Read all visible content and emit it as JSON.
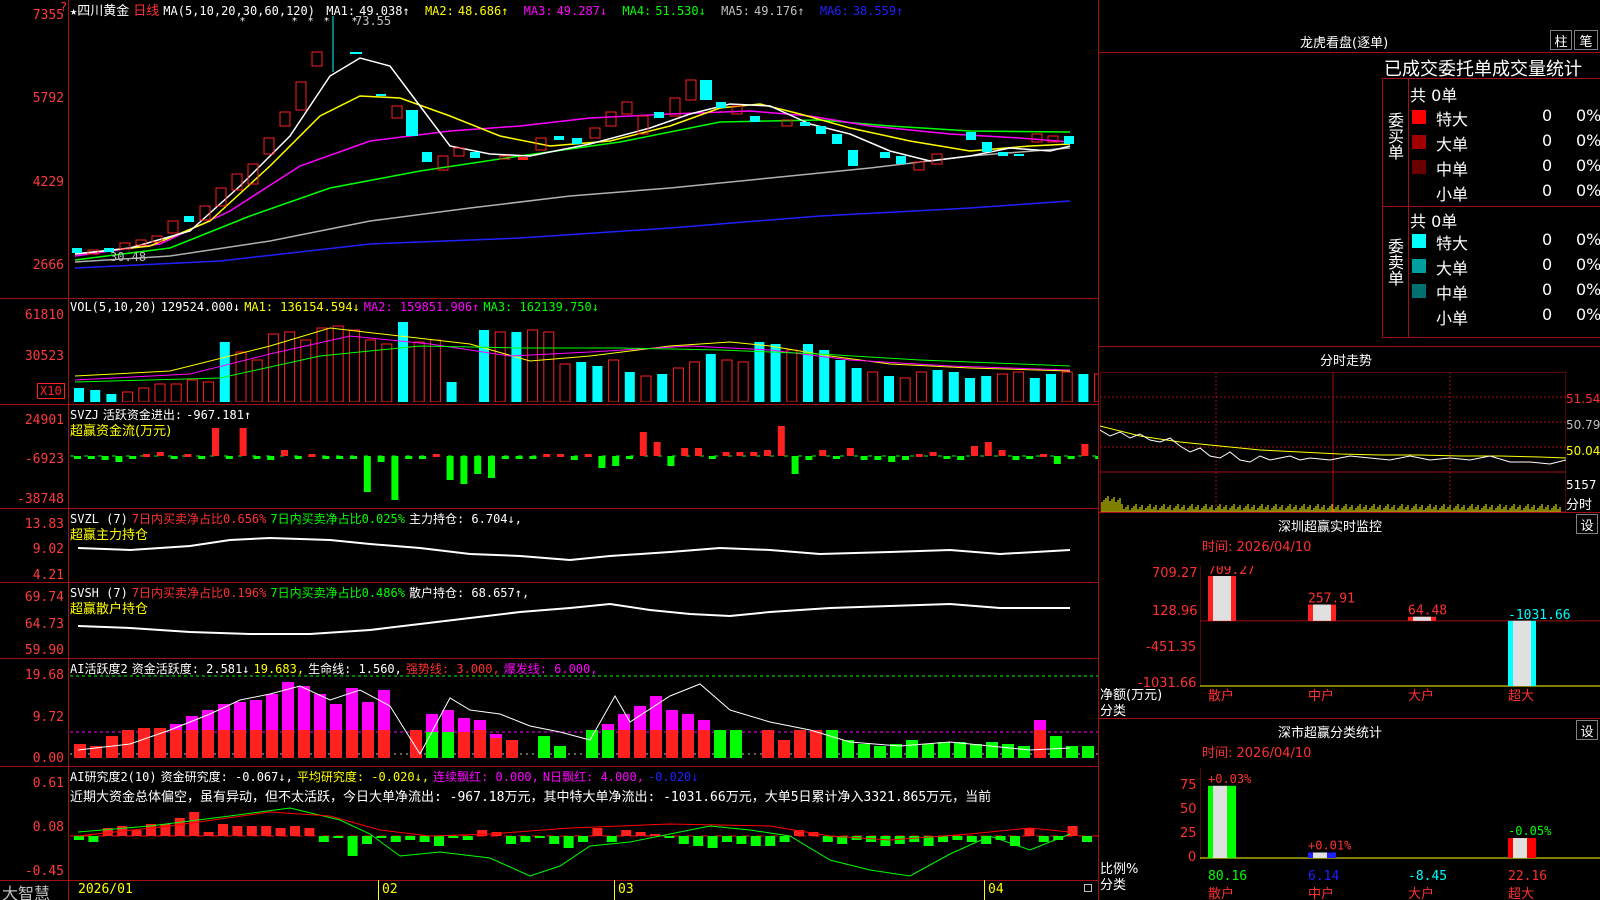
{
  "main": {
    "title_star": "★",
    "stock_name": "四川黄金",
    "period": "日线",
    "ma_def": "MA(5,10,20,30,60,120)",
    "ma": [
      {
        "label": "MA1:",
        "value": "49.038↑",
        "color": "#ffffff"
      },
      {
        "label": "MA2:",
        "value": "48.686↑",
        "color": "#ffff00"
      },
      {
        "label": "MA3:",
        "value": "49.287↓",
        "color": "#ff00ff"
      },
      {
        "label": "MA4:",
        "value": "51.530↓",
        "color": "#00ff00"
      },
      {
        "label": "MA5:",
        "value": "49.176↑",
        "color": "#c0c0c0"
      },
      {
        "label": "MA6:",
        "value": "38.559↑",
        "color": "#2020ff"
      }
    ],
    "y_ticks": [
      "7355",
      "5792",
      "4229",
      "2666"
    ],
    "high_label": "73.55",
    "low_label": "30.48",
    "question_mark": "?",
    "date_ticks": [
      "2026/01",
      "02",
      "03",
      "04"
    ],
    "bottom_logo": "大智慧"
  },
  "vol": {
    "name": "VOL(5,10,20)",
    "value": "129524.000↓",
    "ma1": "MA1: 136154.594↓",
    "ma2": "MA2: 159851.906↑",
    "ma3": "MA3: 162139.750↓",
    "y_ticks": [
      "61810",
      "30523"
    ],
    "unit": "X10"
  },
  "svzj": {
    "name": "SVZJ",
    "label": "活跃资金进出:",
    "value": "-967.181↑",
    "subtitle": "超赢资金流(万元)",
    "y_ticks": [
      "24901",
      "-6923",
      "-38748"
    ]
  },
  "svzl": {
    "name": "SVZL (7)",
    "t1": "7日内买卖净占比0.656%",
    "t2": "7日内买卖净占比0.025%",
    "t3": "主力持仓: 6.704↓,",
    "subtitle": "超赢主力持仓",
    "y_ticks": [
      "13.83",
      "9.02",
      "4.21"
    ]
  },
  "svsh": {
    "name": "SVSH (7)",
    "t1": "7日内买卖净占比0.196%",
    "t2": "7日内买卖净占比0.486%",
    "t3": "散户持仓: 68.657↑,",
    "subtitle": "超赢散户持仓",
    "y_ticks": [
      "69.74",
      "64.73",
      "59.90"
    ]
  },
  "ai1": {
    "name": "AI活跃度2",
    "t1": "资金活跃度: 2.581↓",
    "t2": "19.683,",
    "t3": "生命线: 1.560,",
    "t4": "强势线: 3.000,",
    "t5": "爆发线: 6.000,",
    "y_ticks": [
      "19.68",
      "9.72",
      "0.00"
    ]
  },
  "ai2": {
    "name": "AI研究度2(10)",
    "t1": "资金研究度: -0.067↓,",
    "t2": "平均研究度: -0.020↓,",
    "t3": "连续飘红: 0.000,",
    "t4": "N日飘红: 4.000,",
    "t5": "-0.020↓",
    "comment": "近期大资金总体偏空，虽有异动，但不太活跃，今日大单净流出: -967.18万元，其中特大单净流出: -1031.66万元，大单5日累计净入3321.865万元，当前",
    "y_ticks": [
      "0.61",
      "0.08",
      "-0.45"
    ]
  },
  "lhb": {
    "title": "龙虎看盘(逐单)",
    "btn1": "柱",
    "btn2": "笔",
    "header": "已成交委托单成交量统计",
    "buy_side": "委买单",
    "sell_side": "委卖单",
    "buy_total": "共 0单",
    "sell_total": "共 0单",
    "buy_rows": [
      {
        "name": "特大",
        "count": "0",
        "pct": "0%",
        "color": "#ff0000"
      },
      {
        "name": "大单",
        "count": "0",
        "pct": "0%",
        "color": "#a00000"
      },
      {
        "name": "中单",
        "count": "0",
        "pct": "0%",
        "color": "#6a0000"
      },
      {
        "name": "小单",
        "count": "0",
        "pct": "0%",
        "color": "#000000"
      }
    ],
    "sell_rows": [
      {
        "name": "特大",
        "count": "0",
        "pct": "0%",
        "color": "#00ffff"
      },
      {
        "name": "大单",
        "count": "0",
        "pct": "0%",
        "color": "#00a0a0"
      },
      {
        "name": "中单",
        "count": "0",
        "pct": "0%",
        "color": "#007070"
      },
      {
        "name": "小单",
        "count": "0",
        "pct": "0%",
        "color": "#000000"
      }
    ]
  },
  "intraday": {
    "title": "分时走势",
    "right_ticks": [
      "51.54",
      "50.79",
      "50.04",
      "5157"
    ],
    "unit": "分时"
  },
  "monitor": {
    "title": "深圳超赢实时监控",
    "btn": "设",
    "time": "时间: 2026/04/10",
    "y_ticks": [
      "709.27",
      "128.96",
      "-451.35",
      "-1031.66"
    ],
    "y_unit1": "净额(万元)",
    "y_unit2": "分类",
    "bars": [
      {
        "name": "散户",
        "value": 709.27,
        "label": "709.27"
      },
      {
        "name": "中户",
        "value": 257.91,
        "label": "257.91"
      },
      {
        "name": "大户",
        "value": 64.48,
        "label": "64.48"
      },
      {
        "name": "超大",
        "value": -1031.66,
        "label": "-1031.66"
      }
    ]
  },
  "classify": {
    "title": "深市超赢分类统计",
    "btn": "设",
    "time": "时间: 2026/04/10",
    "y_ticks": [
      "75",
      "50",
      "25",
      "0"
    ],
    "y_unit1": "比例%",
    "y_unit2": "分类",
    "bars": [
      {
        "name": "散户",
        "value": 80.16,
        "label": "80.16",
        "change": "+0.03%",
        "color": "#00ff00"
      },
      {
        "name": "中户",
        "value": 6.14,
        "label": "6.14",
        "change": "+0.01%",
        "color": "#2020ff"
      },
      {
        "name": "大户",
        "value": -8.45,
        "label": "-8.45",
        "change": "",
        "color": "#00ffff"
      },
      {
        "name": "超大",
        "value": 22.16,
        "label": "22.16",
        "change": "-0.05%",
        "color": "#ff0000"
      }
    ]
  }
}
